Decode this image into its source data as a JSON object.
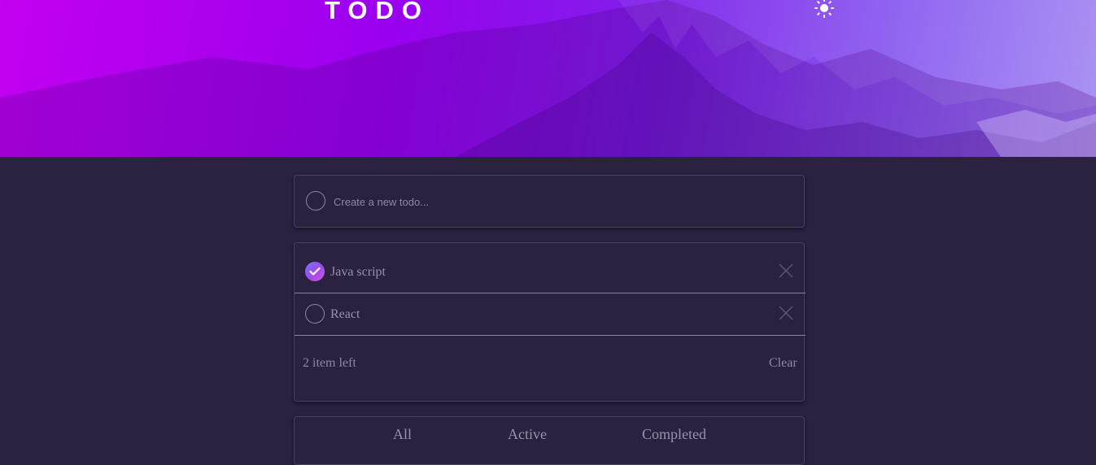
{
  "header": {
    "title": "TODO",
    "theme_toggle_icon": "sun-icon",
    "gradient_colors": [
      "#c300f0",
      "#9a00ee",
      "#7e22ea",
      "#a58cf3"
    ]
  },
  "new_todo": {
    "placeholder": "Create a new todo...",
    "value": ""
  },
  "todos": [
    {
      "label": "Java script",
      "completed": true
    },
    {
      "label": "React",
      "completed": false
    }
  ],
  "footer": {
    "items_left": "2 item left",
    "clear_label": "Clear"
  },
  "filters": {
    "all": "All",
    "active": "Active",
    "completed": "Completed"
  },
  "colors": {
    "background": "#2b2140",
    "check_gradient_start": "#6f78f3",
    "check_gradient_end": "#d05fe4"
  }
}
